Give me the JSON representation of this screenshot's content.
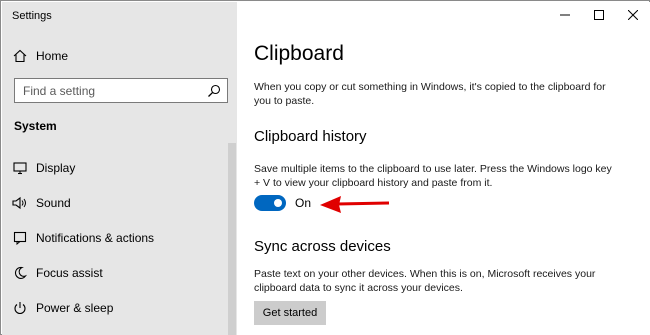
{
  "window": {
    "title": "Settings",
    "controls": {
      "minimize_icon": "minimize-icon",
      "maximize_icon": "maximize-icon",
      "close_icon": "close-icon"
    }
  },
  "sidebar": {
    "home": {
      "label": "Home",
      "icon": "home-icon"
    },
    "search": {
      "placeholder": "Find a setting",
      "icon": "search-icon"
    },
    "section": "System",
    "items": [
      {
        "label": "Display",
        "icon": "display-icon"
      },
      {
        "label": "Sound",
        "icon": "speaker-icon"
      },
      {
        "label": "Notifications & actions",
        "icon": "notifications-icon"
      },
      {
        "label": "Focus assist",
        "icon": "moon-icon"
      },
      {
        "label": "Power & sleep",
        "icon": "power-icon"
      }
    ]
  },
  "main": {
    "title": "Clipboard",
    "intro": "When you copy or cut something in Windows, it's copied to the clipboard for you to paste.",
    "history": {
      "heading": "Clipboard history",
      "description": "Save multiple items to the clipboard to use later. Press the Windows logo key + V to view your clipboard history and paste from it.",
      "toggle_state": "On",
      "toggle_on": true,
      "accent_color": "#0067c0",
      "annotation_color": "#e00000"
    },
    "sync": {
      "heading": "Sync across devices",
      "description": "Paste text on your other devices. When this is on, Microsoft receives your clipboard data to sync it across your devices.",
      "button_label": "Get started"
    }
  }
}
